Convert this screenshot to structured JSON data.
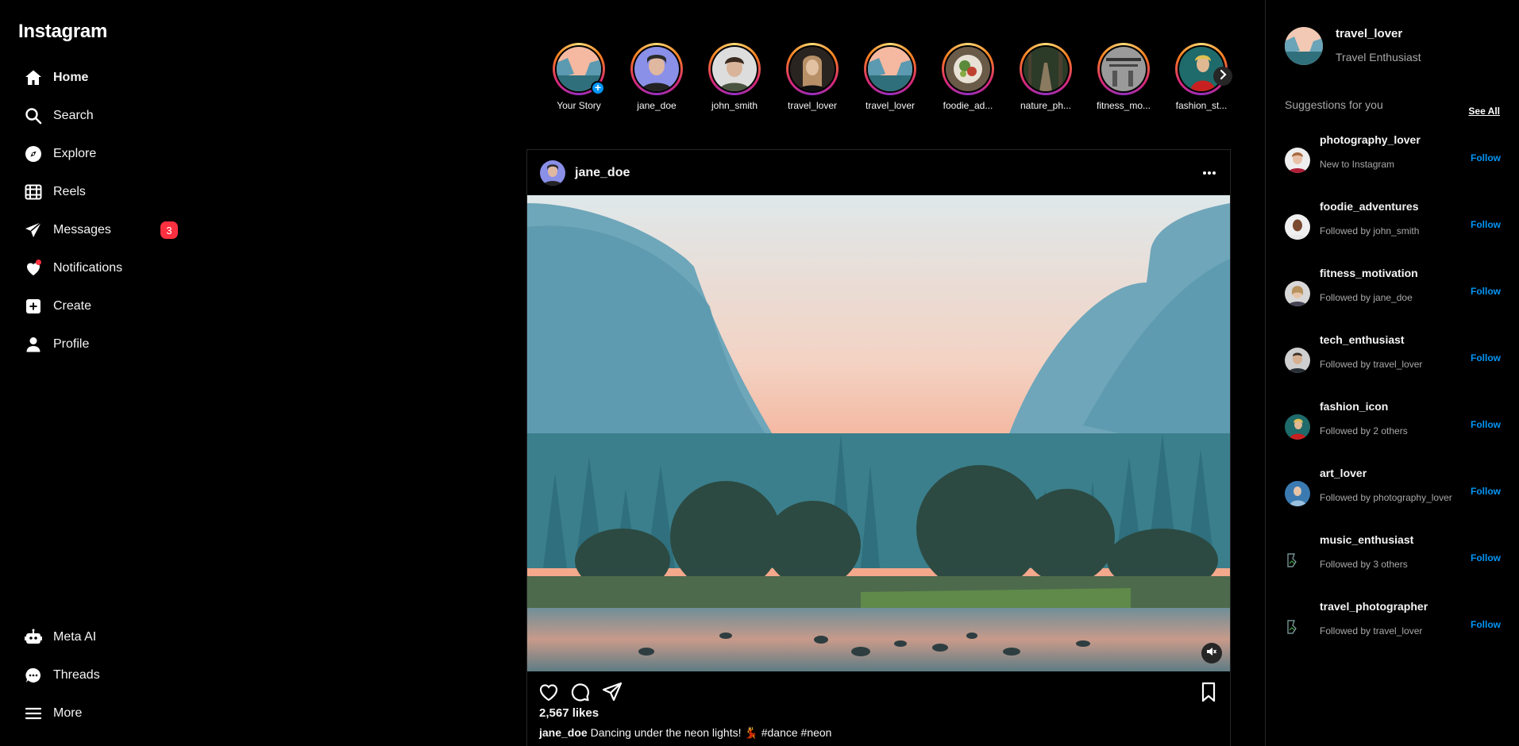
{
  "app": {
    "logo": "Instagram"
  },
  "sidebar": {
    "items": [
      {
        "label": "Home",
        "icon": "home-icon"
      },
      {
        "label": "Search",
        "icon": "search-icon"
      },
      {
        "label": "Explore",
        "icon": "compass-icon"
      },
      {
        "label": "Reels",
        "icon": "reels-icon"
      },
      {
        "label": "Messages",
        "icon": "paper-plane-icon",
        "badge": "3"
      },
      {
        "label": "Notifications",
        "icon": "heart-icon"
      },
      {
        "label": "Create",
        "icon": "plus-square-icon"
      },
      {
        "label": "Profile",
        "icon": "person-icon"
      }
    ],
    "bottom": [
      {
        "label": "Meta AI",
        "icon": "robot-icon"
      },
      {
        "label": "Threads",
        "icon": "threads-icon"
      },
      {
        "label": "More",
        "icon": "hamburger-icon"
      }
    ]
  },
  "stories": [
    {
      "name": "Your Story"
    },
    {
      "name": "jane_doe"
    },
    {
      "name": "john_smith"
    },
    {
      "name": "travel_lover"
    },
    {
      "name": "travel_lover"
    },
    {
      "name": "foodie_ad..."
    },
    {
      "name": "nature_ph..."
    },
    {
      "name": "fitness_mo..."
    },
    {
      "name": "fashion_st..."
    }
  ],
  "post": {
    "username": "jane_doe",
    "likes": "2,567 likes",
    "caption_user": "jane_doe",
    "caption_text": " Dancing under the neon lights! 💃 #dance #neon"
  },
  "right": {
    "username": "travel_lover",
    "subtitle": "Travel Enthusiast",
    "suggestions_title": "Suggestions for you",
    "see_all": "See All",
    "suggestions": [
      {
        "name": "photography_lover",
        "sub": "New to Instagram",
        "action": "Follow"
      },
      {
        "name": "foodie_adventures",
        "sub": "Followed by john_smith",
        "action": "Follow"
      },
      {
        "name": "fitness_motivation",
        "sub": "Followed by jane_doe",
        "action": "Follow"
      },
      {
        "name": "tech_enthusiast",
        "sub": "Followed by travel_lover",
        "action": "Follow"
      },
      {
        "name": "fashion_icon",
        "sub": "Followed by 2 others",
        "action": "Follow"
      },
      {
        "name": "art_lover",
        "sub": "Followed by photography_lover",
        "action": "Follow"
      },
      {
        "name": "music_enthusiast",
        "sub": "Followed by 3 others",
        "action": "Follow"
      },
      {
        "name": "travel_photographer",
        "sub": "Followed by travel_lover",
        "action": "Follow"
      }
    ]
  },
  "colors": {
    "background": "#000000",
    "accent": "#0095f6",
    "badge": "#ff3040",
    "muted": "#a8a8a8"
  }
}
